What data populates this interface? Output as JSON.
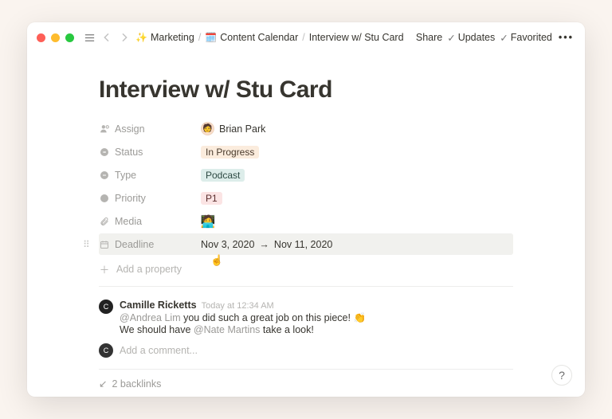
{
  "breadcrumbs": [
    {
      "emoji": "✨",
      "label": "Marketing"
    },
    {
      "emoji": "🗓️",
      "label": "Content Calendar"
    },
    {
      "emoji": "",
      "label": "Interview w/ Stu Card"
    }
  ],
  "top_actions": {
    "share": "Share",
    "updates": "Updates",
    "favorited": "Favorited"
  },
  "title": "Interview w/ Stu Card",
  "properties": {
    "assign": {
      "label": "Assign",
      "person": "Brian Park"
    },
    "status": {
      "label": "Status",
      "value": "In Progress"
    },
    "type": {
      "label": "Type",
      "value": "Podcast"
    },
    "priority": {
      "label": "Priority",
      "value": "P1"
    },
    "media": {
      "label": "Media"
    },
    "deadline": {
      "label": "Deadline",
      "start": "Nov 3, 2020",
      "arrow": "→",
      "end": "Nov 11, 2020"
    }
  },
  "add_property": "Add a property",
  "comment": {
    "author": "Camille Ricketts",
    "time": "Today at 12:34 AM",
    "mention1": "@Andrea Lim",
    "line1_rest": " you did such a great job on this piece! ",
    "clap": "👏",
    "line2_a": "We should have ",
    "mention2": "@Nate Martins",
    "line2_b": " take a look!"
  },
  "add_comment": "Add a comment...",
  "backlinks": "2 backlinks",
  "help": "?"
}
